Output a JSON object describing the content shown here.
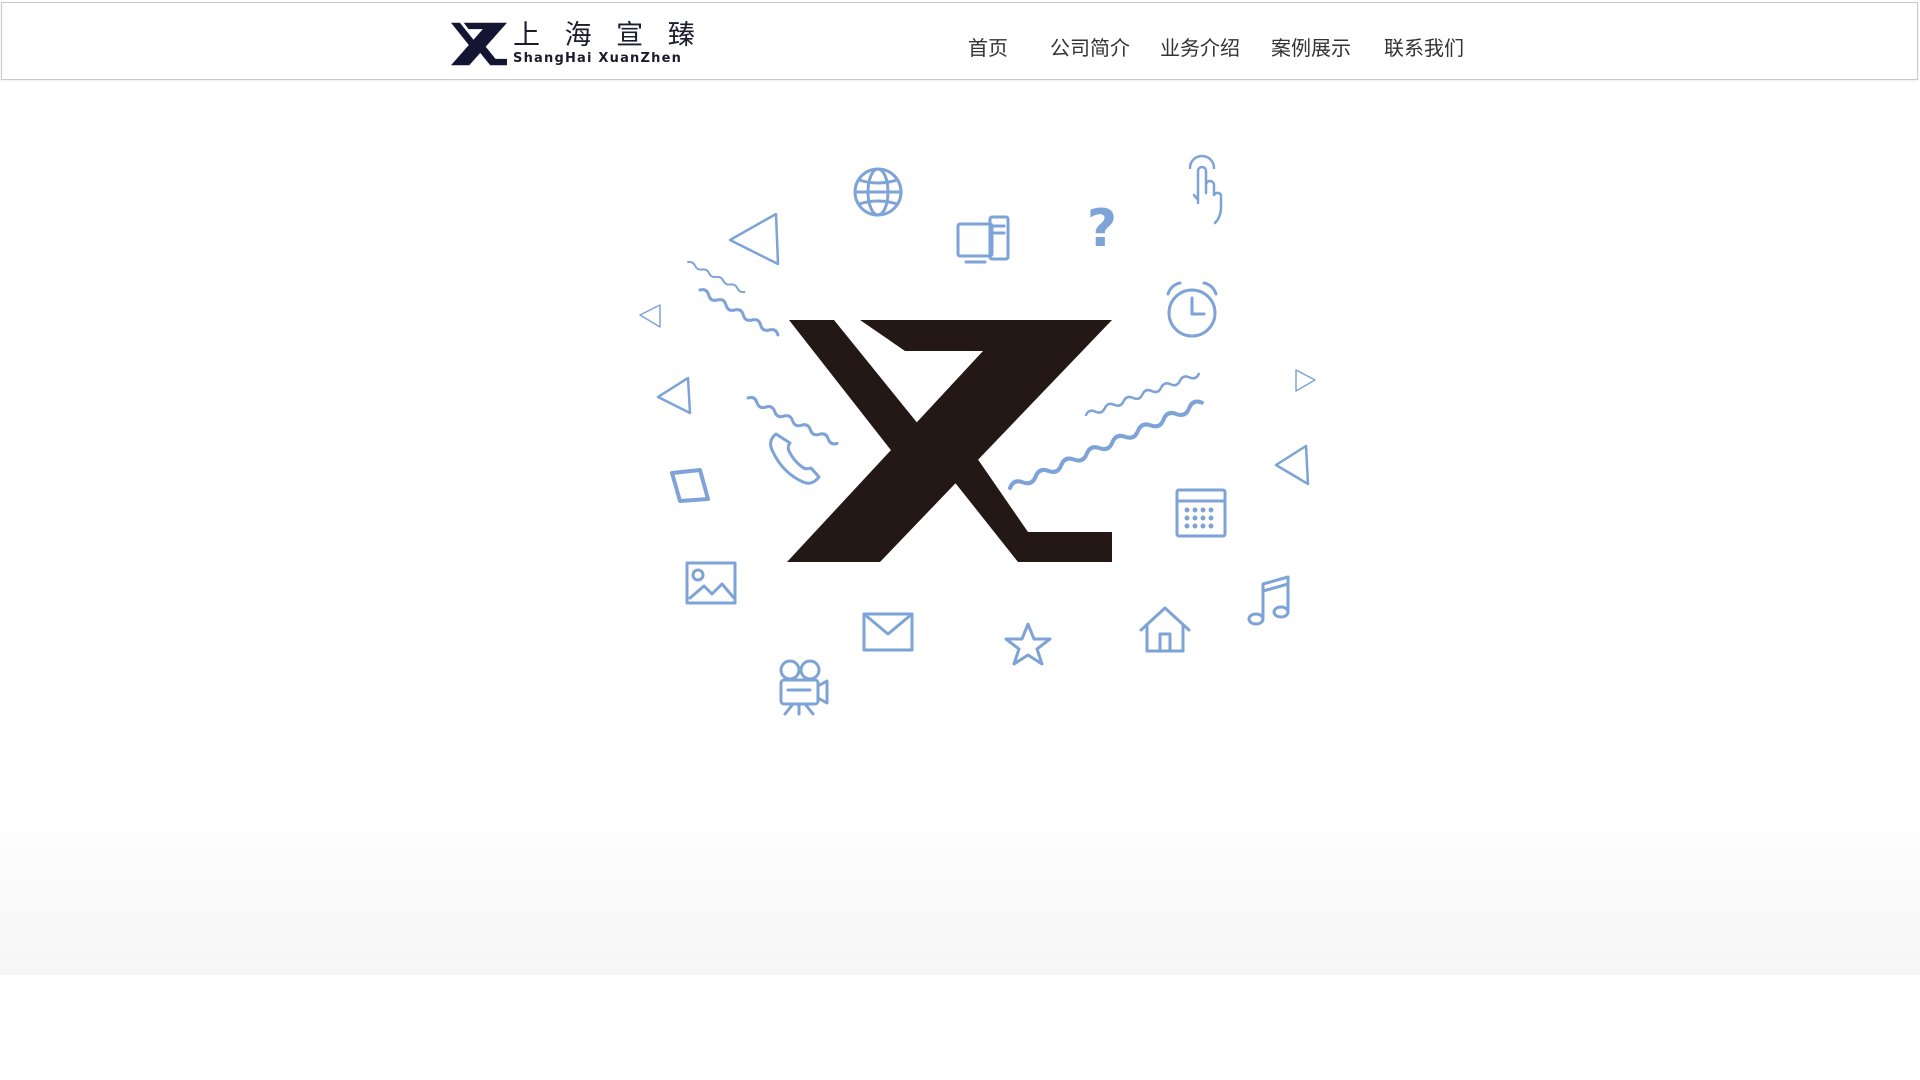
{
  "header": {
    "brand": {
      "name_cn": "上 海 宣 臻",
      "name_en": "ShangHai XuanZhen",
      "logo_icon": "xz-logo-icon"
    },
    "nav": [
      {
        "label": "首页"
      },
      {
        "label": "公司简介"
      },
      {
        "label": "业务介绍"
      },
      {
        "label": "案例展示"
      },
      {
        "label": "联系我们"
      }
    ]
  },
  "hero": {
    "center_logo": "xz-logo-icon",
    "icons": [
      "globe-icon",
      "computer-icon",
      "question-icon",
      "pointer-hand-icon",
      "alarm-clock-icon",
      "phone-icon",
      "calendar-icon",
      "image-icon",
      "envelope-icon",
      "star-icon",
      "home-icon",
      "music-note-icon",
      "film-camera-icon",
      "triangle-icon",
      "diamond-icon"
    ]
  },
  "colors": {
    "icon_blue": "#7ea3d6",
    "logo_black": "#231815",
    "text": "#333333"
  }
}
